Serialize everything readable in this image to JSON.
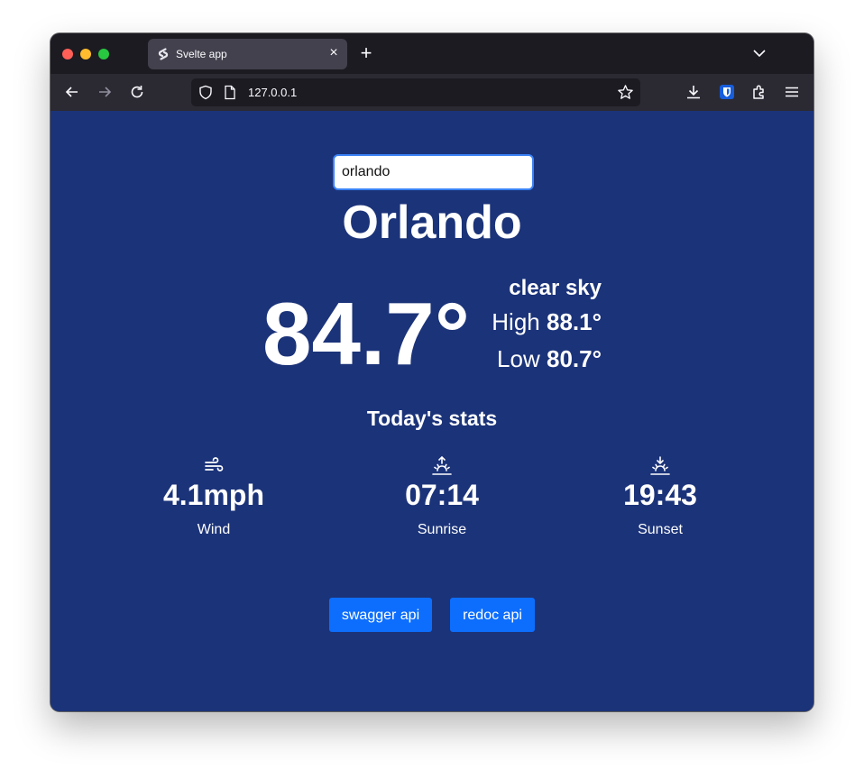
{
  "browser": {
    "tab_title": "Svelte app",
    "url": "127.0.0.1"
  },
  "search": {
    "value": "orlando"
  },
  "weather": {
    "city": "Orlando",
    "temperature": "84.7°",
    "description": "clear sky",
    "high_label": "High",
    "high_value": "88.1°",
    "low_label": "Low",
    "low_value": "80.7°"
  },
  "stats": {
    "title": "Today's stats",
    "wind": {
      "value": "4.1mph",
      "label": "Wind",
      "icon": "wind-icon"
    },
    "sunrise": {
      "value": "07:14",
      "label": "Sunrise",
      "icon": "sunrise-icon"
    },
    "sunset": {
      "value": "19:43",
      "label": "Sunset",
      "icon": "sunset-icon"
    }
  },
  "buttons": {
    "swagger": "swagger api",
    "redoc": "redoc api"
  },
  "colors": {
    "background": "#1b3379",
    "button": "#0d6efd"
  }
}
